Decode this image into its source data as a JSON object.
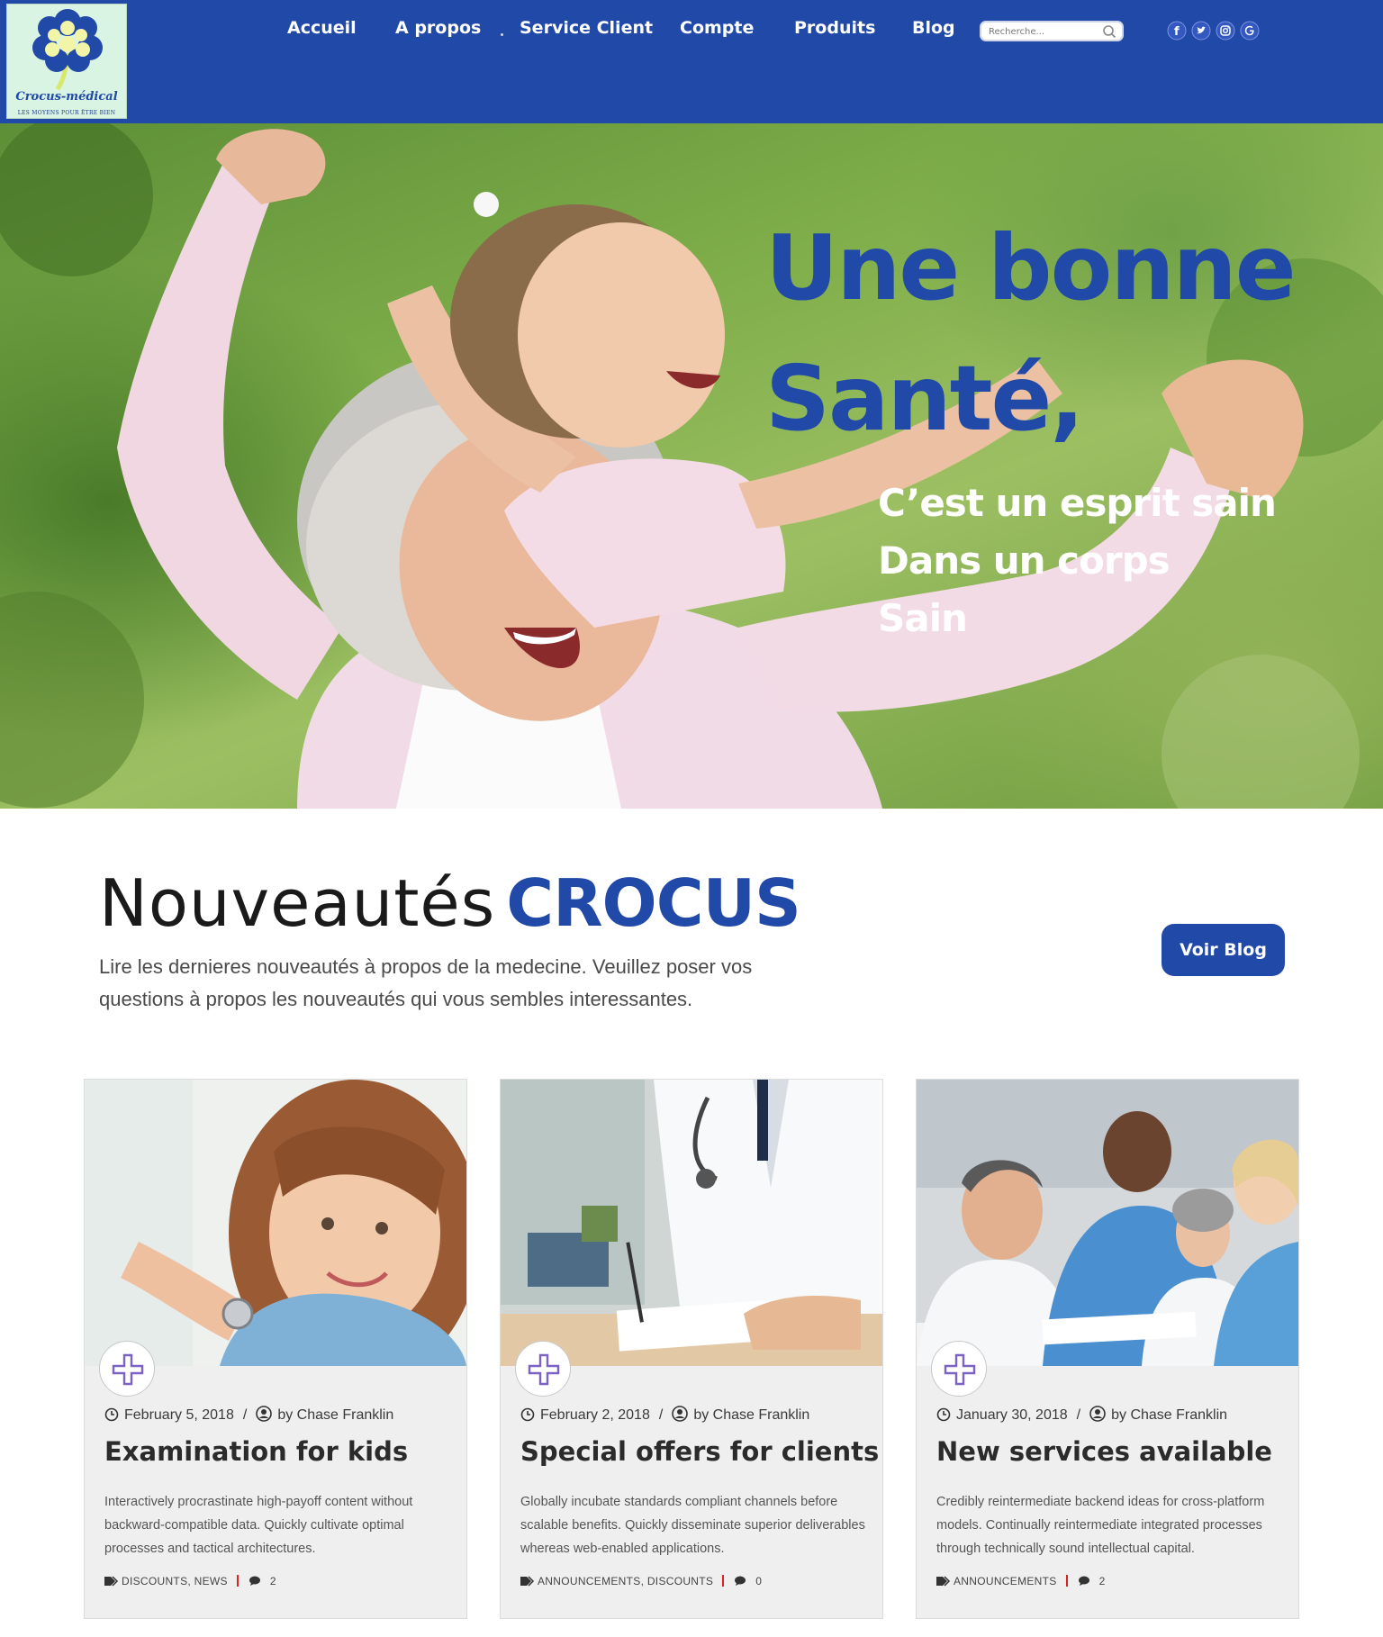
{
  "logo": {
    "name": "Crocus-médical",
    "tagline": "LES MOYENS POUR ÊTRE BIEN"
  },
  "nav": {
    "items": [
      "Accueil",
      "A propos",
      "Service Client",
      "Compte",
      "Produits",
      "Blog"
    ]
  },
  "search": {
    "placeholder": "Recherche..."
  },
  "social": [
    "facebook-icon",
    "twitter-icon",
    "instagram-icon",
    "google-icon"
  ],
  "colors": {
    "brand": "#2149a8",
    "hero_title": "#2149a8",
    "accent_red": "#dd2222"
  },
  "hero": {
    "title_line1": "Une bonne",
    "title_line2": "Santé,",
    "sub_line1": "C’est un esprit sain",
    "sub_line2": "Dans un corps",
    "sub_line3": "Sain"
  },
  "section": {
    "title_light": "Nouveautés",
    "title_brand": "CROCUS",
    "description": "Lire les dernieres nouveautés à propos de la medecine. Veuillez poser vos questions à propos les nouveautés qui vous sembles interessantes.",
    "button": "Voir Blog"
  },
  "cards": [
    {
      "date": "February 5, 2018",
      "author": "by Chase Franklin",
      "title": "Examination for kids",
      "text": "Interactively procrastinate high-payoff content without backward-compatible data. Quickly cultivate optimal processes and tactical architectures.",
      "tags": "DISCOUNTS, NEWS",
      "comments": "2"
    },
    {
      "date": "February 2, 2018",
      "author": "by Chase Franklin",
      "title": "Special offers for clients",
      "text": "Globally incubate standards compliant channels before scalable benefits. Quickly disseminate superior deliverables whereas web-enabled applications.",
      "tags": "ANNOUNCEMENTS, DISCOUNTS",
      "comments": "0"
    },
    {
      "date": "January 30, 2018",
      "author": "by Chase Franklin",
      "title": "New services available",
      "text": "Credibly reintermediate backend ideas for cross-platform models. Continually reintermediate integrated processes through technically sound intellectual capital.",
      "tags": "ANNOUNCEMENTS",
      "comments": "2"
    }
  ]
}
